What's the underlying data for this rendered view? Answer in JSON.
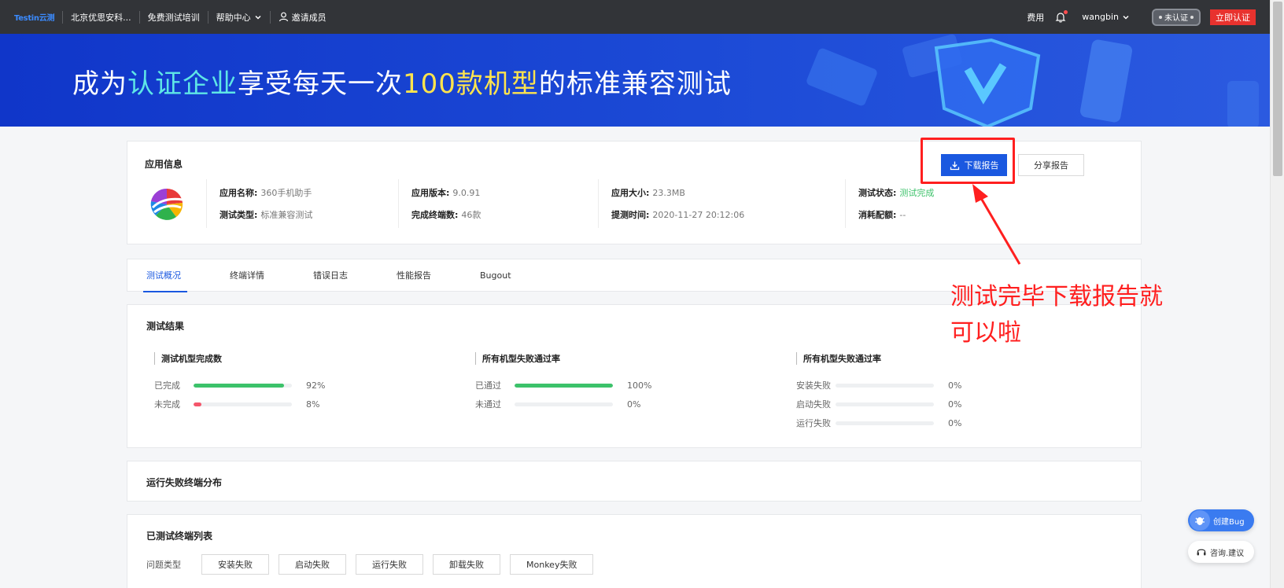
{
  "topnav": {
    "logo": "Testin云测",
    "org": "北京优思安科...",
    "training": "免费测试培训",
    "help": "帮助中心",
    "invite": "邀请成员",
    "fee": "费用",
    "username": "wangbin",
    "unverified": "未认证",
    "verify_now": "立即认证"
  },
  "banner": {
    "part1": "成为",
    "highlight1": "认证企业",
    "part2": "享受每天一次",
    "highlight2": "100款机型",
    "part3": "的标准兼容测试"
  },
  "app_info": {
    "section_title": "应用信息",
    "download_report": "下载报告",
    "share_report": "分享报告",
    "col1": [
      {
        "label": "应用名称:",
        "value": "360手机助手"
      },
      {
        "label": "测试类型:",
        "value": "标准兼容测试"
      }
    ],
    "col2": [
      {
        "label": "应用版本:",
        "value": "9.0.91"
      },
      {
        "label": "完成终端数:",
        "value": "46款"
      }
    ],
    "col3": [
      {
        "label": "应用大小:",
        "value": "23.3MB"
      },
      {
        "label": "提测时间:",
        "value": "2020-11-27 20:12:06"
      }
    ],
    "col4": [
      {
        "label": "测试状态:",
        "value": "测试完成"
      },
      {
        "label": "消耗配额:",
        "value": "--"
      }
    ]
  },
  "tabs": [
    "测试概况",
    "终端详情",
    "错误日志",
    "性能报告",
    "Bugout"
  ],
  "result": {
    "section_title": "测试结果",
    "groups": [
      {
        "title": "测试机型完成数",
        "rows": [
          {
            "label": "已完成",
            "percent": 92,
            "text": "92%",
            "color": "#3cc26a"
          },
          {
            "label": "未完成",
            "percent": 8,
            "text": "8%",
            "color": "#f5566b"
          }
        ]
      },
      {
        "title": "所有机型失败通过率",
        "rows": [
          {
            "label": "已通过",
            "percent": 100,
            "text": "100%",
            "color": "#3cc26a"
          },
          {
            "label": "未通过",
            "percent": 0,
            "text": "0%",
            "color": "#f5566b"
          }
        ]
      },
      {
        "title": "所有机型失败通过率",
        "rows": [
          {
            "label": "安装失败",
            "percent": 0,
            "text": "0%",
            "color": "#f5566b"
          },
          {
            "label": "启动失败",
            "percent": 0,
            "text": "0%",
            "color": "#f5566b"
          },
          {
            "label": "运行失败",
            "percent": 0,
            "text": "0%",
            "color": "#f5566b"
          }
        ]
      }
    ]
  },
  "distribution": {
    "section_title": "运行失败终端分布"
  },
  "tested_list": {
    "section_title": "已测试终端列表",
    "filter_label": "问题类型",
    "filters": [
      "安装失败",
      "启动失败",
      "运行失败",
      "卸载失败",
      "Monkey失败"
    ]
  },
  "annotation": {
    "line1": "测试完毕下载报告就",
    "line2": "可以啦"
  },
  "floating": {
    "create_bug": "创建Bug",
    "consult": "咨询.建议"
  },
  "colors": {
    "primary": "#1a58e0",
    "success": "#3cc26a",
    "danger": "#e8322e",
    "annotation": "#ff1f1f"
  }
}
